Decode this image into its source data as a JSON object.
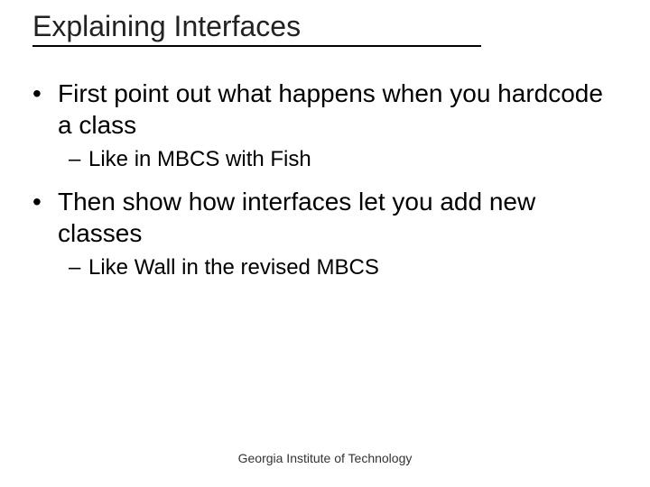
{
  "title": "Explaining Interfaces",
  "bullets": {
    "b1": "First point out what happens when you hardcode a class",
    "b1a": "Like in MBCS with Fish",
    "b2": "Then show how interfaces let you add new classes",
    "b2a": "Like Wall in the revised MBCS"
  },
  "markers": {
    "l1": "•",
    "l2": "–"
  },
  "footer": "Georgia Institute of Technology"
}
